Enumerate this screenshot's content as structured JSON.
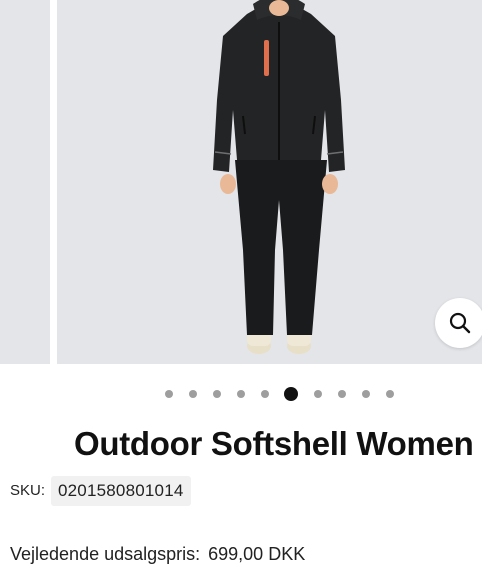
{
  "gallery": {
    "image_alt": "Outdoor Softshell Women product photo",
    "slide_count": 10,
    "active_slide_index": 5,
    "zoom_icon": "magnifier-icon"
  },
  "product": {
    "title": "Outdoor Softshell Women",
    "sku_label": "SKU:",
    "sku_value": "0201580801014",
    "price_label": "Vejledende udsalgspris:",
    "price_value": "699,00 DKK"
  },
  "colors": {
    "gallery_background": "#e4e5e9",
    "jacket": "#232425",
    "zipper_accent": "#e0704d",
    "active_dot": "#111111",
    "inactive_dot": "#9e9e9e"
  }
}
